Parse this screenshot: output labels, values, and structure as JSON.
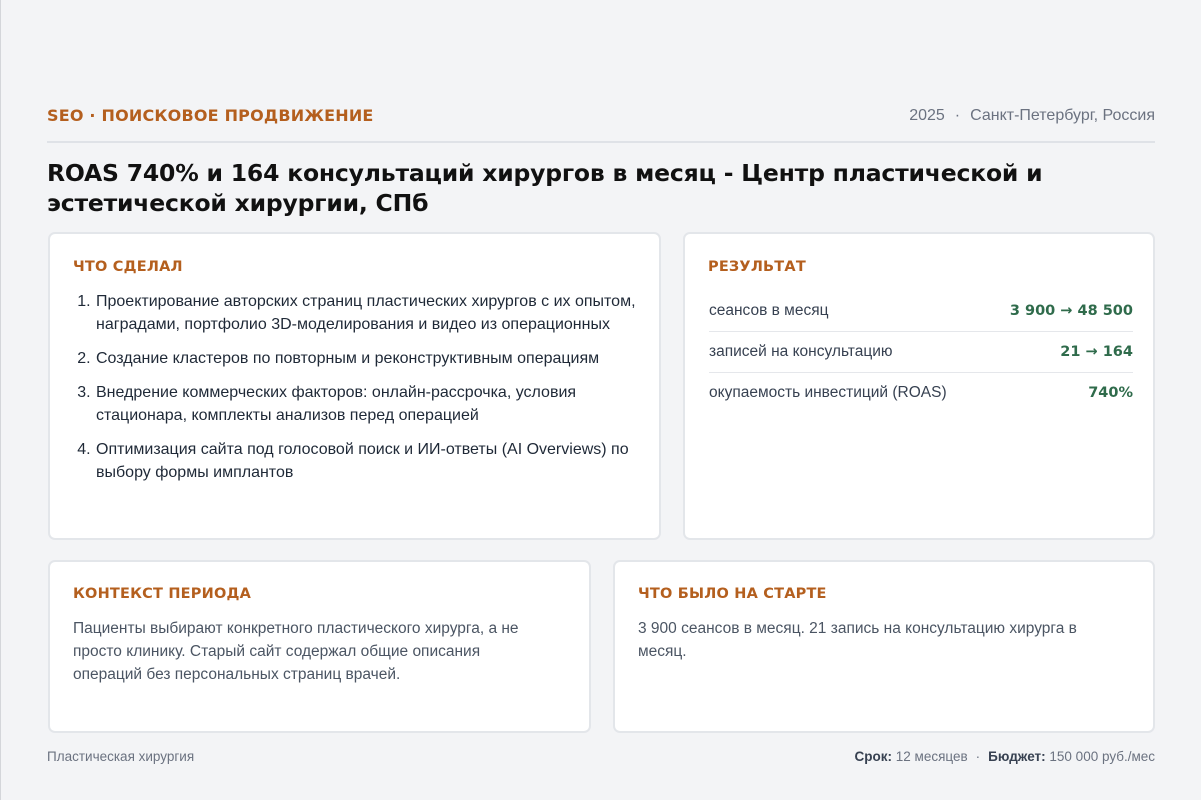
{
  "header": {
    "category": "SEO · ПОИСКОВОЕ ПРОДВИЖЕНИЕ",
    "year": "2025",
    "separator": "·",
    "location": "Санкт-Петербург, Россия"
  },
  "title": "ROAS 740% и 164 консультаций хирургов в месяц - Центр пластической и эстетической хирургии, СПб",
  "did": {
    "heading": "ЧТО СДЕЛАЛ",
    "items": [
      "Проектирование авторских страниц пластических хирургов с их опытом, наградами, портфолио 3D-моделирования и видео из операционных",
      "Создание кластеров по повторным и реконструктивным операциям",
      "Внедрение коммерческих факторов: онлайн-рассрочка, условия стационара, комплекты анализов перед операцией",
      "Оптимизация сайта под голосовой поиск и ИИ-ответы (AI Overviews) по выбору формы имплантов"
    ]
  },
  "result": {
    "heading": "РЕЗУЛЬТАТ",
    "metrics": [
      {
        "label": "сеансов в месяц",
        "value": "3 900 → 48 500"
      },
      {
        "label": "записей на консультацию",
        "value": "21 → 164"
      },
      {
        "label": "окупаемость инвестиций (ROAS)",
        "value": "740%"
      }
    ],
    "value_color": "#2f6b4b"
  },
  "context": {
    "heading": "КОНТЕКСТ ПЕРИОДА",
    "text": "Пациенты выбирают конкретного пластического хирурга, а не просто клинику. Старый сайт содержал общие описания операций без персональных страниц врачей."
  },
  "start": {
    "heading": "ЧТО БЫЛО НА СТАРТЕ",
    "text": "3 900 сеансов в месяц. 21 запись на консультацию хирурга в месяц."
  },
  "footer": {
    "niche": "Пластическая хирургия",
    "term_label": "Срок:",
    "term_value": "12 месяцев",
    "separator": "·",
    "budget_label": "Бюджет:",
    "budget_value": "150 000 руб./мес"
  },
  "colors": {
    "accent": "#b45f1e",
    "background": "#f3f4f6",
    "card": "#ffffff"
  }
}
